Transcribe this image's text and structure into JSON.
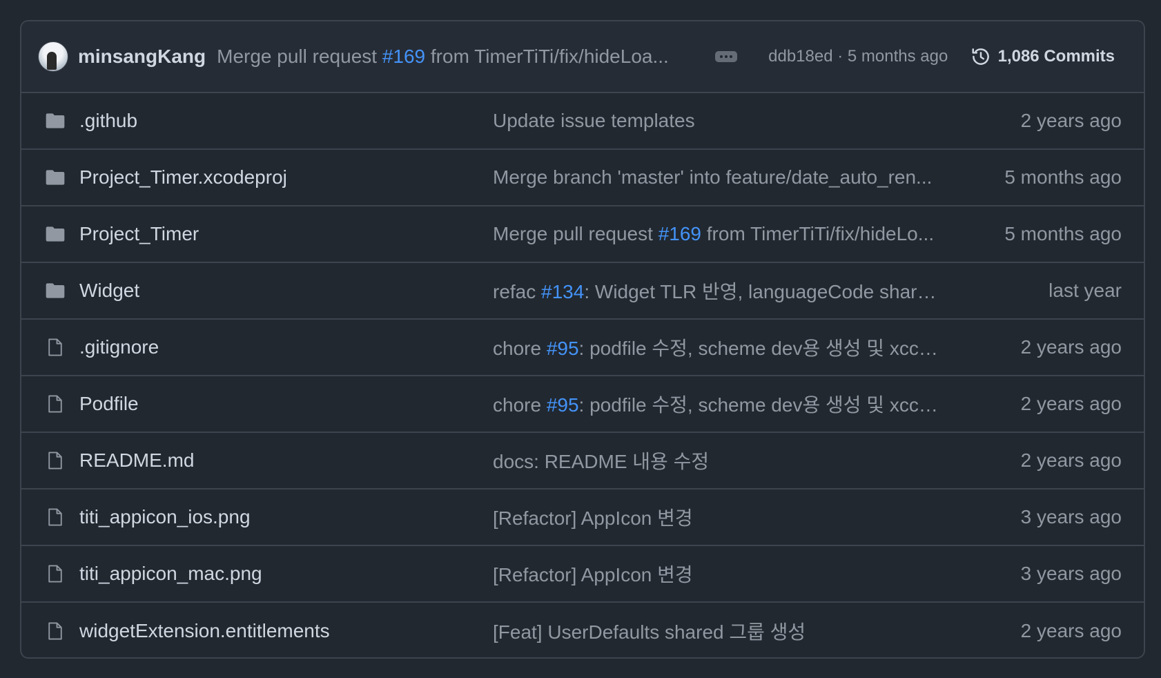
{
  "commit_bar": {
    "author": "minsangKang",
    "message_prefix": "Merge pull request ",
    "message_link": "#169",
    "message_suffix": " from TimerTiTi/fix/hideLoa...",
    "sha_time": "ddb18ed · 5 months ago",
    "commits_label": "1,086 Commits"
  },
  "files": [
    {
      "type": "folder",
      "name": ".github",
      "msg_pre": "Update issue templates",
      "msg_link": "",
      "msg_post": "",
      "time": "2 years ago"
    },
    {
      "type": "folder",
      "name": "Project_Timer.xcodeproj",
      "msg_pre": "Merge branch 'master' into feature/date_auto_ren...",
      "msg_link": "",
      "msg_post": "",
      "time": "5 months ago"
    },
    {
      "type": "folder",
      "name": "Project_Timer",
      "msg_pre": "Merge pull request ",
      "msg_link": "#169",
      "msg_post": " from TimerTiTi/fix/hideLo...",
      "time": "5 months ago"
    },
    {
      "type": "folder",
      "name": "Widget",
      "msg_pre": "refac ",
      "msg_link": "#134",
      "msg_post": ": Widget TLR 반영, languageCode share...",
      "time": "last year"
    },
    {
      "type": "file",
      "name": ".gitignore",
      "msg_pre": "chore ",
      "msg_link": "#95",
      "msg_post": ": podfile 수정, scheme dev용 생성 및 xcco...",
      "time": "2 years ago"
    },
    {
      "type": "file",
      "name": "Podfile",
      "msg_pre": "chore ",
      "msg_link": "#95",
      "msg_post": ": podfile 수정, scheme dev용 생성 및 xcco...",
      "time": "2 years ago"
    },
    {
      "type": "file",
      "name": "README.md",
      "msg_pre": "docs: README 내용 수정",
      "msg_link": "",
      "msg_post": "",
      "time": "2 years ago"
    },
    {
      "type": "file",
      "name": "titi_appicon_ios.png",
      "msg_pre": "[Refactor] AppIcon 변경",
      "msg_link": "",
      "msg_post": "",
      "time": "3 years ago"
    },
    {
      "type": "file",
      "name": "titi_appicon_mac.png",
      "msg_pre": "[Refactor] AppIcon 변경",
      "msg_link": "",
      "msg_post": "",
      "time": "3 years ago"
    },
    {
      "type": "file",
      "name": "widgetExtension.entitlements",
      "msg_pre": "[Feat] UserDefaults shared 그룹 생성",
      "msg_link": "",
      "msg_post": "",
      "time": "2 years ago"
    }
  ],
  "colors": {
    "background": "#212830",
    "header_bg": "#262c36",
    "border": "#3d444d",
    "text_primary": "#d1d7e0",
    "text_muted": "#9198a1",
    "link": "#4493f8",
    "icon": "#9198a1"
  }
}
